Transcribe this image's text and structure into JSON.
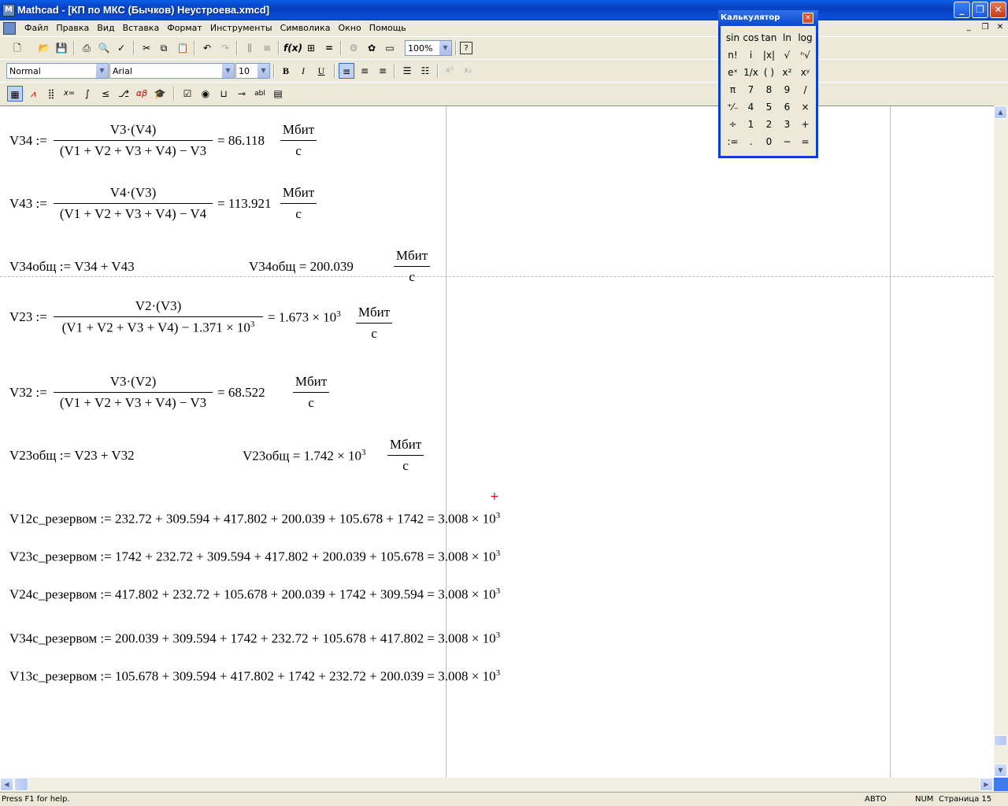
{
  "window": {
    "title": "Mathcad - [КП по МКС (Бычков) Неустроева.xmcd]",
    "app_icon_text": "M"
  },
  "menu": [
    "Файл",
    "Правка",
    "Вид",
    "Вставка",
    "Формат",
    "Инструменты",
    "Символика",
    "Окно",
    "Помощь"
  ],
  "toolbar": {
    "zoom": "100%",
    "style": "Normal",
    "font": "Arial",
    "size": "10"
  },
  "equations": [
    {
      "lhs": "V34 :=",
      "num": "V3·(V4)",
      "den": "(V1 + V2 + V3 + V4) − V3",
      "eq": "= 86.118",
      "unit_num": "Мбит",
      "unit_den": "с"
    },
    {
      "lhs": "V43 :=",
      "num": "V4·(V3)",
      "den": "(V1 + V2 + V3 + V4) − V4",
      "eq": "= 113.921",
      "unit_num": "Мбит",
      "unit_den": "с"
    },
    {
      "lhs": "V23 :=",
      "num": "V2·(V3)",
      "den_a": "(V1 + V2 + V3 + V4) − 1.371 × 10",
      "den_exp": "3",
      "eq_a": "= 1.673 × 10",
      "eq_exp": "3",
      "unit_num": "Мбит",
      "unit_den": "с"
    },
    {
      "lhs": "V32 :=",
      "num": "V3·(V2)",
      "den": "(V1 + V2 + V3 + V4) − V3",
      "eq": "= 68.522",
      "unit_num": "Мбит",
      "unit_den": "с"
    }
  ],
  "totals": {
    "v34_def": "V34общ := V34 + V43",
    "v34_res": "V34общ = 200.039",
    "v23_def": "V23общ := V23 + V32",
    "v23_res": "V23общ = 1.742 × 10",
    "v23_exp": "3",
    "unit_num": "Мбит",
    "unit_den": "с"
  },
  "reserve": [
    {
      "text": "V12с_резервом := 232.72 + 309.594 + 417.802 + 200.039 + 105.678 + 1742 = 3.008 × 10",
      "exp": "3"
    },
    {
      "text": "V23с_резервом := 1742 + 232.72 + 309.594 + 417.802 + 200.039 + 105.678 = 3.008 × 10",
      "exp": "3"
    },
    {
      "text": "V24с_резервом := 417.802 + 232.72 + 105.678 + 200.039 + 1742 + 309.594 = 3.008 × 10",
      "exp": "3"
    },
    {
      "text": "V34с_резервом := 200.039 + 309.594 + 1742 + 232.72 + 105.678 + 417.802 = 3.008 × 10",
      "exp": "3"
    },
    {
      "text": "V13с_резервом := 105.678 + 309.594 + 417.802 + 1742 + 232.72 + 200.039 = 3.008 × 10",
      "exp": "3"
    }
  ],
  "status": {
    "help": "Press F1 for help.",
    "mode": "АВТО",
    "num": "NUM",
    "page": "Страница 15"
  },
  "calculator": {
    "title": "Калькулятор",
    "keys": [
      "sin",
      "cos",
      "tan",
      "ln",
      "log",
      "n!",
      "i",
      "|x|",
      "√",
      "ⁿ√",
      "eˣ",
      "1/x",
      "( )",
      "x²",
      "xʸ",
      "π",
      "7",
      "8",
      "9",
      "/",
      "⁺⁄₋",
      "4",
      "5",
      "6",
      "×",
      "÷",
      "1",
      "2",
      "3",
      "+",
      ":=",
      ".",
      "0",
      "−",
      "="
    ]
  }
}
